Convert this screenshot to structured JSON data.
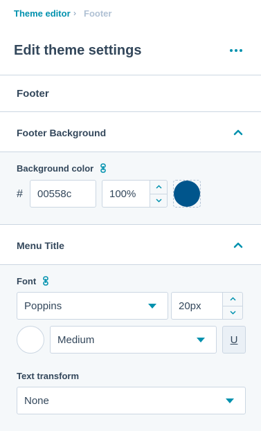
{
  "breadcrumb": {
    "parent": "Theme editor",
    "separator": "›",
    "current": "Footer"
  },
  "header": {
    "title": "Edit theme settings",
    "more_icon": "more-horizontal-icon"
  },
  "section": {
    "title": "Footer"
  },
  "footer_background": {
    "heading": "Footer Background",
    "background_color": {
      "label": "Background color",
      "hash": "#",
      "hex_value": "00558c",
      "opacity_value": "100%",
      "swatch_color": "#00558c"
    }
  },
  "menu_title": {
    "heading": "Menu Title",
    "font": {
      "label": "Font",
      "family": "Poppins",
      "size": "20px",
      "color_swatch": "#ffffff",
      "weight": "Medium",
      "underline_label": "U"
    },
    "text_transform": {
      "label": "Text transform",
      "value": "None"
    }
  },
  "colors": {
    "accent": "#0091ae",
    "text": "#33475b",
    "panel": "#f5f8fa",
    "border": "#cbd6e2"
  }
}
